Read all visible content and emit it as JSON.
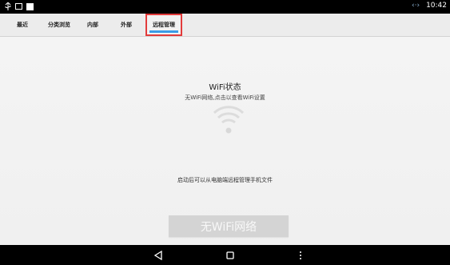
{
  "status_bar": {
    "time": "10:42",
    "icons": [
      "usb-icon",
      "photo-icon",
      "notification-icon",
      "sync-icon"
    ]
  },
  "tabs": [
    {
      "label": "最近",
      "active": false
    },
    {
      "label": "分类浏览",
      "active": false
    },
    {
      "label": "内部",
      "active": false
    },
    {
      "label": "外部",
      "active": false
    },
    {
      "label": "远程管理",
      "active": true
    }
  ],
  "wifi": {
    "title": "WiFi状态",
    "subtitle": "无WiFi网络,点击以查看WiFi设置",
    "icon": "wifi-icon"
  },
  "hint": "启动后可以从电脑端远程管理手机文件",
  "button": {
    "label": "无WiFi网络"
  },
  "nav": [
    "back-icon",
    "home-icon",
    "menu-icon"
  ],
  "colors": {
    "active_tab_border": "#e23b3b",
    "active_tab_underline": "#3b9be6",
    "content_bg": "#f2f2f2",
    "button_bg": "#d4d4d4"
  }
}
